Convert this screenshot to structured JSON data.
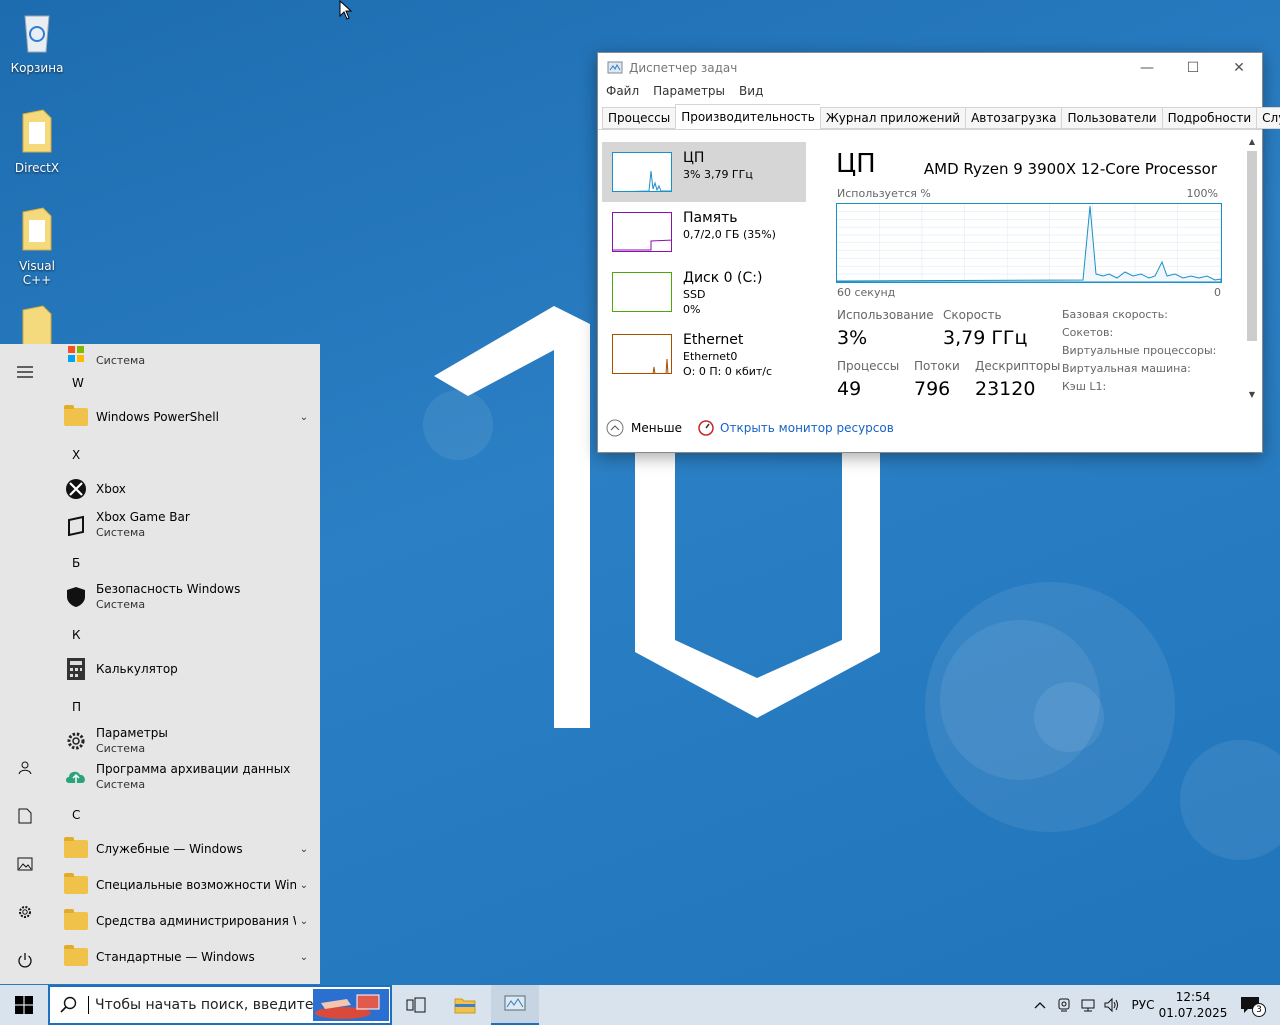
{
  "desktop": {
    "icons": [
      {
        "label": "Корзина"
      },
      {
        "label": "DirectX"
      },
      {
        "label": "Visual C++"
      }
    ]
  },
  "start_menu": {
    "truncated_top_item": {
      "subtitle": "Система"
    },
    "letters": [
      "W",
      "X",
      "Б",
      "К",
      "П",
      "С"
    ],
    "apps": [
      {
        "name": "Windows PowerShell"
      },
      {
        "name": "Xbox"
      },
      {
        "name": "Xbox Game Bar",
        "subtitle": "Система"
      },
      {
        "name": "Безопасность Windows",
        "subtitle": "Система"
      },
      {
        "name": "Калькулятор"
      },
      {
        "name": "Параметры",
        "subtitle": "Система"
      },
      {
        "name": "Программа архивации данных",
        "subtitle": "Система"
      },
      {
        "name": "Служебные — Windows"
      },
      {
        "name": "Специальные возможности Win..."
      },
      {
        "name": "Средства администрирования W..."
      },
      {
        "name": "Стандартные — Windows"
      }
    ]
  },
  "taskbar": {
    "search_placeholder": "Чтобы начать поиск, введите з",
    "language": "РУС",
    "time": "12:54",
    "date": "01.07.2025",
    "notification_count": "3"
  },
  "task_manager": {
    "title": "Диспетчер задач",
    "menu": [
      "Файл",
      "Параметры",
      "Вид"
    ],
    "tabs": [
      "Процессы",
      "Производительность",
      "Журнал приложений",
      "Автозагрузка",
      "Пользователи",
      "Подробности",
      "Службы"
    ],
    "active_tab": "Производительность",
    "sidebar": [
      {
        "title": "ЦП",
        "line1": "3% 3,79 ГГц",
        "line2": ""
      },
      {
        "title": "Память",
        "line1": "0,7/2,0 ГБ (35%)",
        "line2": ""
      },
      {
        "title": "Диск 0 (C:)",
        "line1": "SSD",
        "line2": "0%"
      },
      {
        "title": "Ethernet",
        "line1": "Ethernet0",
        "line2": "О: 0 П: 0 кбит/с"
      }
    ],
    "cpu": {
      "heading": "ЦП",
      "processor": "AMD Ryzen 9 3900X 12-Core Processor",
      "graph_label": "Используется %",
      "graph_max": "100%",
      "graph_time": "60 секунд",
      "graph_min": "0",
      "usage_label": "Использование",
      "usage_value": "3%",
      "speed_label": "Скорость",
      "speed_value": "3,79 ГГц",
      "processes_label": "Процессы",
      "processes_value": "49",
      "threads_label": "Потоки",
      "threads_value": "796",
      "handles_label": "Дескрипторы",
      "handles_value": "23120",
      "right_labels": [
        "Базовая скорость:",
        "Сокетов:",
        "Виртуальные процессоры:",
        "Виртуальная машина:",
        "Кэш L1:"
      ]
    },
    "footer": {
      "less_label": "Меньше",
      "monitor_link": "Открыть монитор ресурсов"
    }
  }
}
